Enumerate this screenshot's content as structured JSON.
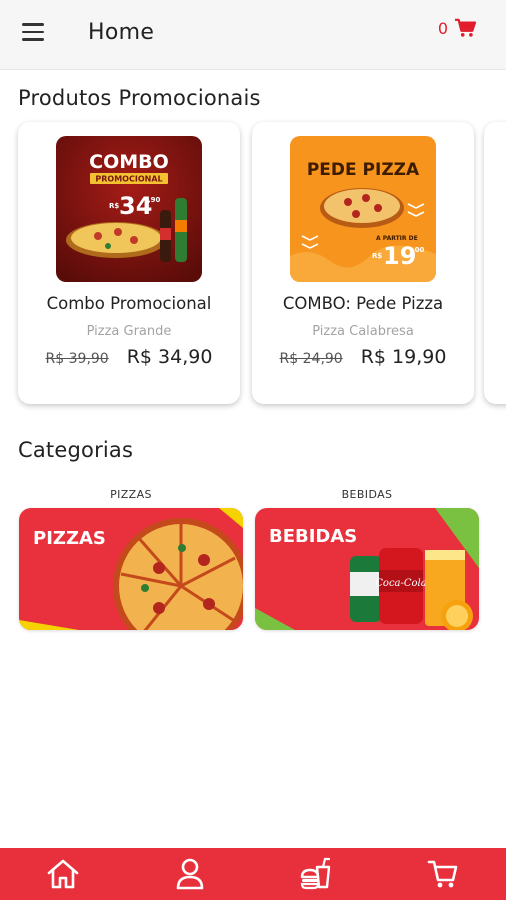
{
  "header": {
    "title": "Home",
    "cart_count": "0",
    "menu_icon": "hamburger-menu-icon",
    "cart_icon": "cart-icon"
  },
  "promos": {
    "section_title": "Produtos Promocionais",
    "items": [
      {
        "name": "Combo Promocional",
        "subtitle": "Pizza Grande",
        "old_price": "R$ 39,90",
        "price": "R$ 34,90",
        "image": {
          "headline": "COMBO",
          "ribbon": "PROMOCIONAL",
          "price_prefix": "R$",
          "price_big": "34",
          "price_cents": ",90"
        }
      },
      {
        "name": "COMBO: Pede Pizza",
        "subtitle": "Pizza Calabresa",
        "old_price": "R$ 24,90",
        "price": "R$ 19,90",
        "image": {
          "headline": "PEDE PIZZA",
          "tagline": "A PARTIR DE",
          "price_prefix": "R$",
          "price_big": "19",
          "price_cents": ",00"
        }
      }
    ]
  },
  "categories": {
    "section_title": "Categorias",
    "items": [
      {
        "label": "PIZZAS",
        "banner_text": "PIZZAS"
      },
      {
        "label": "BEBIDAS",
        "banner_text": "BEBIDAS"
      }
    ]
  },
  "bottom_nav": {
    "items": [
      "home-icon",
      "user-icon",
      "food-combo-icon",
      "cart-icon"
    ]
  },
  "colors": {
    "accent": "#e8303d",
    "price_red": "#e21d2b",
    "promo1_bg": "#7a1410",
    "promo2_bg": "#f7941d",
    "banner_red": "#e8313c",
    "banner_yellow": "#f5d200",
    "banner_green": "#7ac142"
  }
}
